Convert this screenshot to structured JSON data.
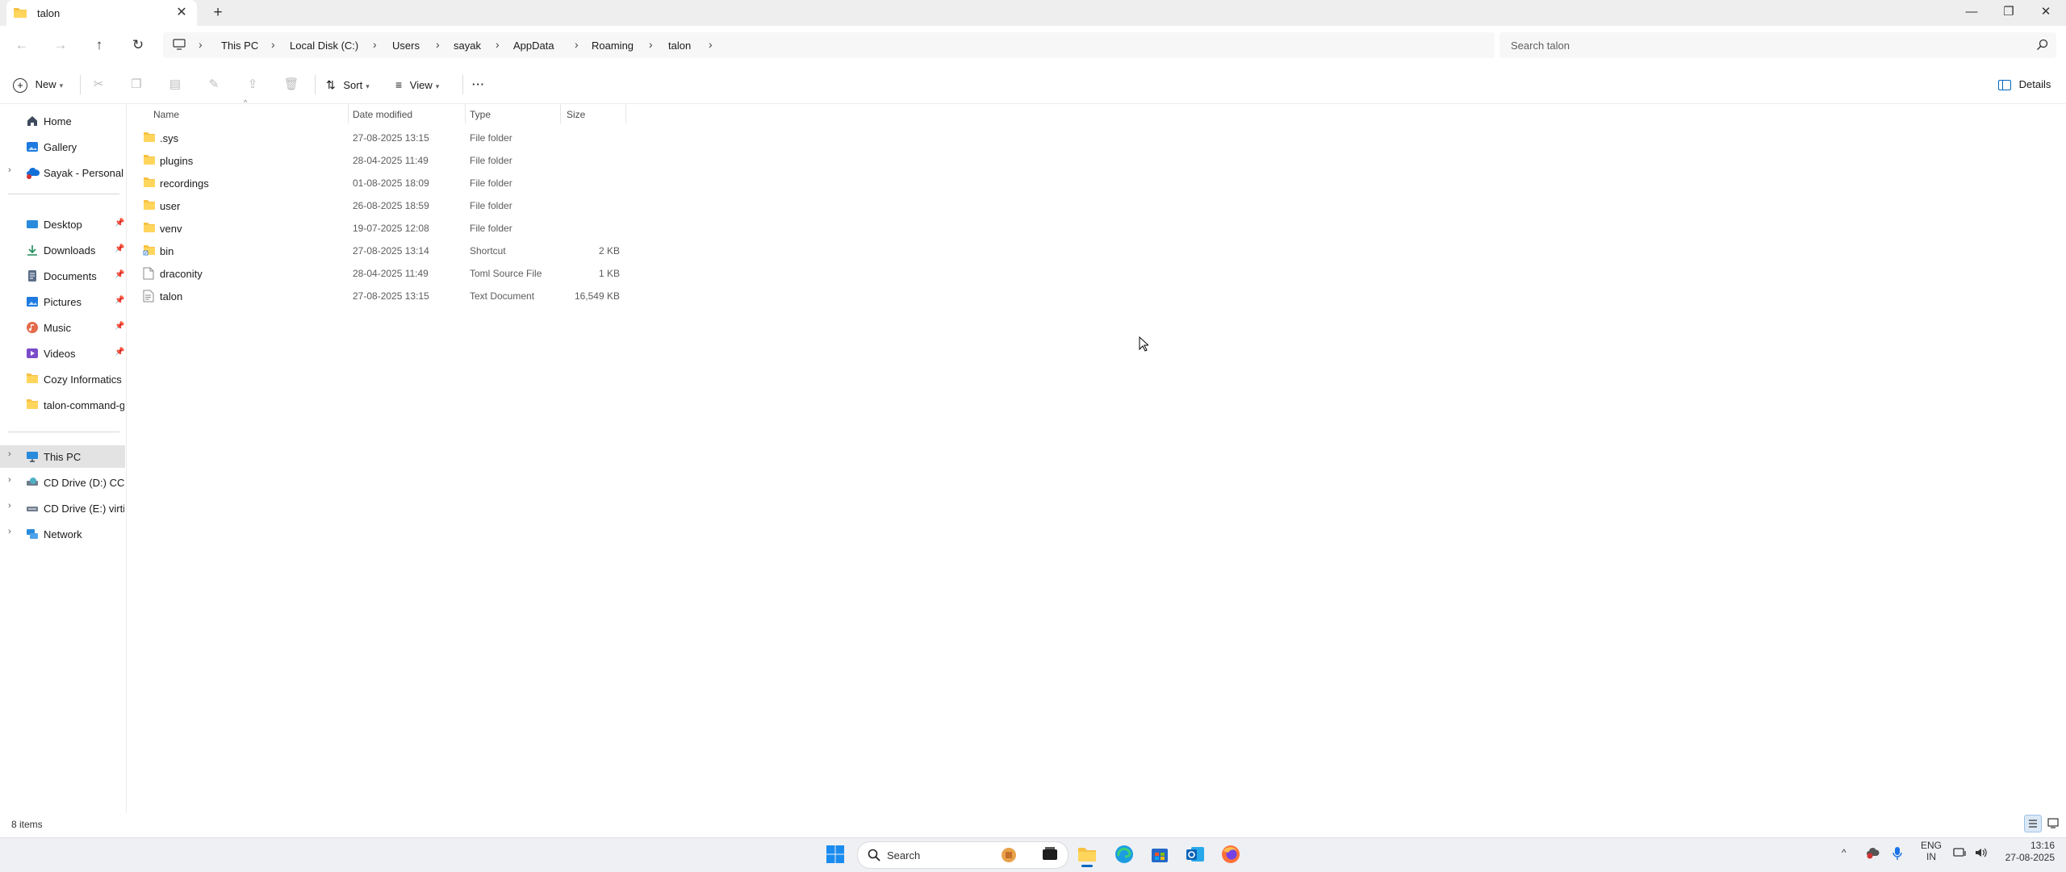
{
  "window": {
    "tab_title": "talon",
    "new_tab_symbol": "+",
    "close_tab_symbol": "✕",
    "minimize_symbol": "—",
    "maximize_symbol": "❐",
    "close_symbol": "✕"
  },
  "breadcrumb": [
    "This PC",
    "Local Disk (C:)",
    "Users",
    "sayak",
    "AppData",
    "Roaming",
    "talon"
  ],
  "search": {
    "placeholder": "Search talon"
  },
  "command_bar": {
    "new_label": "New",
    "sort_label": "Sort",
    "view_label": "View",
    "more_label": "···",
    "details_label": "Details"
  },
  "sidebar": {
    "home": "Home",
    "gallery": "Gallery",
    "onedrive": "Sayak - Personal",
    "quick_access": [
      {
        "label": "Desktop",
        "icon": "desktop-icon"
      },
      {
        "label": "Downloads",
        "icon": "downloads-icon"
      },
      {
        "label": "Documents",
        "icon": "documents-icon"
      },
      {
        "label": "Pictures",
        "icon": "pictures-icon"
      },
      {
        "label": "Music",
        "icon": "music-icon"
      },
      {
        "label": "Videos",
        "icon": "videos-icon"
      },
      {
        "label": "Cozy Informatics",
        "icon": "folder-icon"
      },
      {
        "label": "talon-command-g",
        "icon": "folder-icon"
      }
    ],
    "this_pc": "This PC",
    "drives": [
      "CD Drive (D:) CCCC",
      "CD Drive (E:) virtio-"
    ],
    "network": "Network"
  },
  "columns": {
    "name": "Name",
    "date": "Date modified",
    "type": "Type",
    "size": "Size"
  },
  "files": [
    {
      "name": ".sys",
      "date": "27-08-2025 13:15",
      "type": "File folder",
      "size": "",
      "icon": "folder-icon"
    },
    {
      "name": "plugins",
      "date": "28-04-2025 11:49",
      "type": "File folder",
      "size": "",
      "icon": "folder-icon"
    },
    {
      "name": "recordings",
      "date": "01-08-2025 18:09",
      "type": "File folder",
      "size": "",
      "icon": "folder-icon"
    },
    {
      "name": "user",
      "date": "26-08-2025 18:59",
      "type": "File folder",
      "size": "",
      "icon": "folder-icon"
    },
    {
      "name": "venv",
      "date": "19-07-2025 12:08",
      "type": "File folder",
      "size": "",
      "icon": "folder-icon"
    },
    {
      "name": "bin",
      "date": "27-08-2025 13:14",
      "type": "Shortcut",
      "size": "2 KB",
      "icon": "shortcut-folder-icon"
    },
    {
      "name": "draconity",
      "date": "28-04-2025 11:49",
      "type": "Toml Source File",
      "size": "1 KB",
      "icon": "file-icon"
    },
    {
      "name": "talon",
      "date": "27-08-2025 13:15",
      "type": "Text Document",
      "size": "16,549 KB",
      "icon": "text-file-icon"
    }
  ],
  "status": {
    "item_count": "8 items"
  },
  "taskbar": {
    "search_label": "Search",
    "lang": "ENG",
    "region": "IN",
    "time": "13:16",
    "date": "27-08-2025"
  },
  "colors": {
    "accent": "#0067c0",
    "folder": "#f6c244",
    "selected_bg": "#e3e3e3"
  }
}
